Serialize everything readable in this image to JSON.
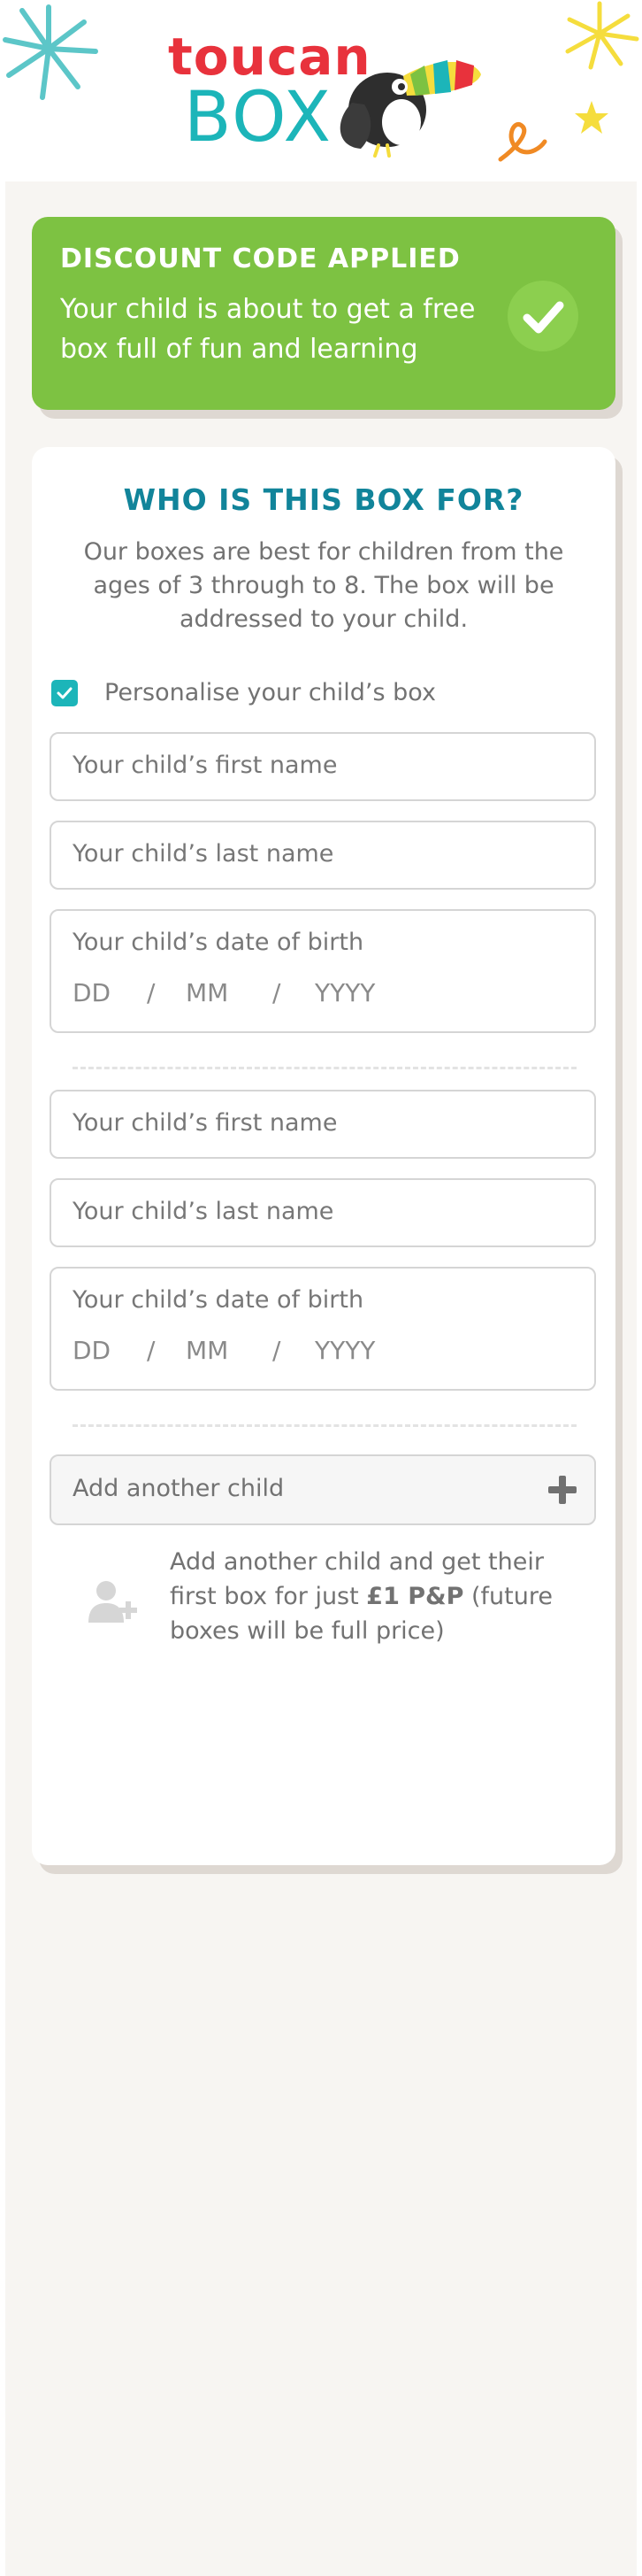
{
  "brand": {
    "logo_text_top": "toucan",
    "logo_text_bottom": "BOX",
    "colors": {
      "red": "#e8323c",
      "teal": "#1cb5b9",
      "green": "#7dc242",
      "title_teal": "#11849a"
    }
  },
  "banner": {
    "title": "DISCOUNT CODE APPLIED",
    "text": "Your child is about to get a free box full of fun and learning",
    "icon": "checkmark-icon"
  },
  "card": {
    "title": "WHO IS THIS BOX FOR?",
    "intro": "Our boxes are best for children from the ages of 3 through to 8. The box will be addressed to your child.",
    "personalise": {
      "label": "Personalise your child’s box",
      "checked": true
    },
    "children": [
      {
        "first_name_placeholder": "Your child’s first name",
        "last_name_placeholder": "Your child’s last name",
        "dob_label": "Your child’s date of birth",
        "dob_day": "DD",
        "dob_month": "MM",
        "dob_year": "YYYY",
        "dob_sep": "/"
      },
      {
        "first_name_placeholder": "Your child’s first name",
        "last_name_placeholder": "Your child’s last name",
        "dob_label": "Your child’s date of birth",
        "dob_day": "DD",
        "dob_month": "MM",
        "dob_year": "YYYY",
        "dob_sep": "/"
      }
    ],
    "add_child": {
      "label": "Add another child",
      "icon": "plus-icon"
    },
    "promo": {
      "text_before": "Add another child and get their first box for just ",
      "text_bold": "£1 P&P",
      "text_after": " (future boxes will be full price)",
      "icon": "add-user-icon"
    }
  }
}
